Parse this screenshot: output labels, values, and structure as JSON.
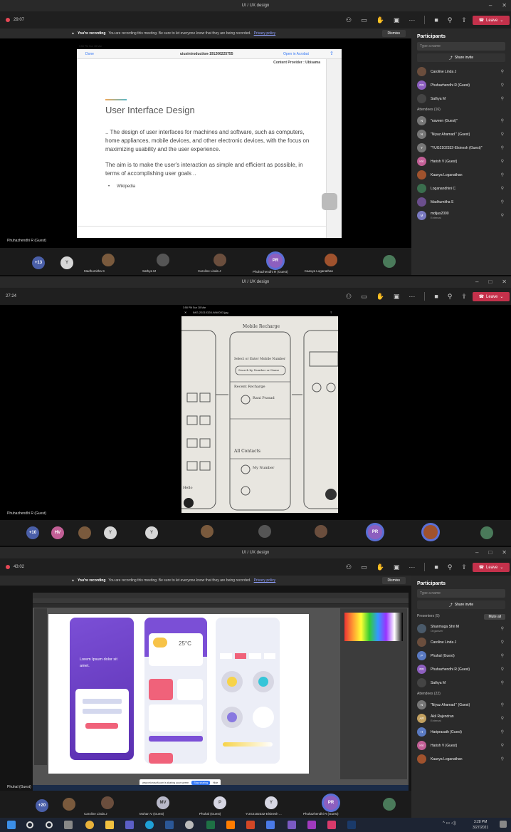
{
  "window_title": "UI / UX design",
  "panels": [
    {
      "timer": "29:07"
    },
    {
      "timer": "27:24"
    },
    {
      "timer": "43:02"
    }
  ],
  "toolbar": {
    "leave_label": "Leave"
  },
  "banner": {
    "bold": "You're recording",
    "text": "You are recording this meeting. Be sure to let everyone know that they are being recorded.",
    "link": "Privacy policy",
    "dismiss": "Dismiss"
  },
  "slide": {
    "time": "3:58 PM  Sun 28 Mar",
    "done": "Done",
    "filename": "uiuxintroduction-191206225755",
    "open_in": "Open in Acrobat",
    "top_text": "Content Provider : Ubisama",
    "heading": "User Interface Design",
    "para1": ".. The design of user interfaces for machines and software, such as computers, home appliances, mobile devices, and other electronic devices, with the focus on maximizing usability and the user experience.",
    "para2": "The aim is to make the user's interaction as simple and efficient as possible, in terms of accomplishing user goals ..",
    "source": "Wikipedia"
  },
  "sketch": {
    "time": "3:58 PM  Sun 28 Mar",
    "filename": "IMG-20210328-WA0003.jpg",
    "texts": [
      "Mobile Recharge",
      "Select or Enter Mobile Number",
      "Search by Number or Name",
      "Recent Recharge",
      "Rani Prasad",
      "All Contacts",
      "My Number",
      "Hello"
    ]
  },
  "names": {
    "p1": "Phuhazhendhi R (Guest)",
    "p2": "Phuhazhendhi R (Guest)",
    "p3": "Phuhal (Guest)"
  },
  "gallery1": {
    "count": "+13",
    "y": "Y",
    "pr": "PR",
    "names": [
      "Madhumitha S",
      "Sathya M",
      "Caroline Linda J",
      "Phuhazhendhi R (Guest)",
      "Kaavya Loganathan"
    ]
  },
  "gallery2": {
    "count": "+10",
    "hv": "HV",
    "y1": "Y",
    "y2": "Y",
    "pr": "PR"
  },
  "gallery3": {
    "count": "+20",
    "mv": "MV",
    "p": "P",
    "y": "Y",
    "pr": "PR",
    "names": [
      "Caroline Linda J",
      "Mohan V (Guest)",
      "Phuhal (Guest)",
      "YUG2102332-Elsinesh ...",
      "Phuhazhendhi R (Guest)"
    ]
  },
  "side1": {
    "title": "Participants",
    "search": "Type a name",
    "share": "Share invite",
    "top": [
      {
        "name": "Caroline Linda J",
        "initials": "",
        "color": "#6b4e3d"
      },
      {
        "name": "Phuhazhendhi R (Guest)",
        "initials": "PR",
        "color": "#8d5fbf"
      },
      {
        "name": "Sathya M",
        "initials": "",
        "color": "#444"
      }
    ],
    "section": "Attendees (16)",
    "people": [
      {
        "name": "\"naveen (Guest)\"",
        "initials": "N",
        "color": "#777"
      },
      {
        "name": "\"Niyaz Ahamad \" (Guest)",
        "initials": "N",
        "color": "#777"
      },
      {
        "name": "\"YUG2102332-Elsinesh (Guest)\"",
        "initials": "Y",
        "color": "#777"
      },
      {
        "name": "Harish V (Guest)",
        "initials": "HV",
        "color": "#c25f96"
      },
      {
        "name": "Kaavya Loganathan",
        "initials": "",
        "color": "#a0522d"
      },
      {
        "name": "Loganandhini C",
        "initials": "",
        "color": "#3a6e4e"
      },
      {
        "name": "Madhumitha S",
        "initials": "",
        "color": "#6b4e8d"
      },
      {
        "name": "mdijas2000",
        "initials": "M",
        "color": "#7a7ac2",
        "sub": "External"
      }
    ]
  },
  "side3": {
    "title": "Participants",
    "search": "Type a name",
    "share": "Share invite",
    "presenters": "Presenters (5)",
    "mute_all": "Mute all",
    "top": [
      {
        "name": "Shanmuga Shri M",
        "initials": "",
        "color": "#4a5a6a",
        "sub": "Organizer"
      },
      {
        "name": "Caroline Linda J",
        "initials": "",
        "color": "#6b4e3d"
      },
      {
        "name": "Phuhal (Guest)",
        "initials": "P",
        "color": "#5a7ac2"
      },
      {
        "name": "Phuhazhendhi R (Guest)",
        "initials": "PR",
        "color": "#8d5fbf"
      },
      {
        "name": "Sathya M",
        "initials": "",
        "color": "#444"
      }
    ],
    "section": "Attendees (22)",
    "people": [
      {
        "name": "\"Niyaz Ahamad \" (Guest)",
        "initials": "N",
        "color": "#777"
      },
      {
        "name": "Akil Rajendran",
        "initials": "AR",
        "color": "#c2a05f",
        "sub": "External"
      },
      {
        "name": "Hariprasath (Guest)",
        "initials": "H",
        "color": "#5a7ac2"
      },
      {
        "name": "Harish V (Guest)",
        "initials": "HV",
        "color": "#c25f96"
      },
      {
        "name": "Kaavya Loganathan",
        "initials": "",
        "color": "#a0522d"
      }
    ]
  },
  "design": {
    "lorem": "Lorem Ipsum dolor sit amet.",
    "temp": "25°C"
  },
  "share_bar": {
    "text": "www.microsoft.com is sharing your screen",
    "stop": "Stop sharing",
    "hide": "Hide"
  },
  "taskbar": {
    "time": "3:28 PM",
    "date": "3/27/2021"
  }
}
